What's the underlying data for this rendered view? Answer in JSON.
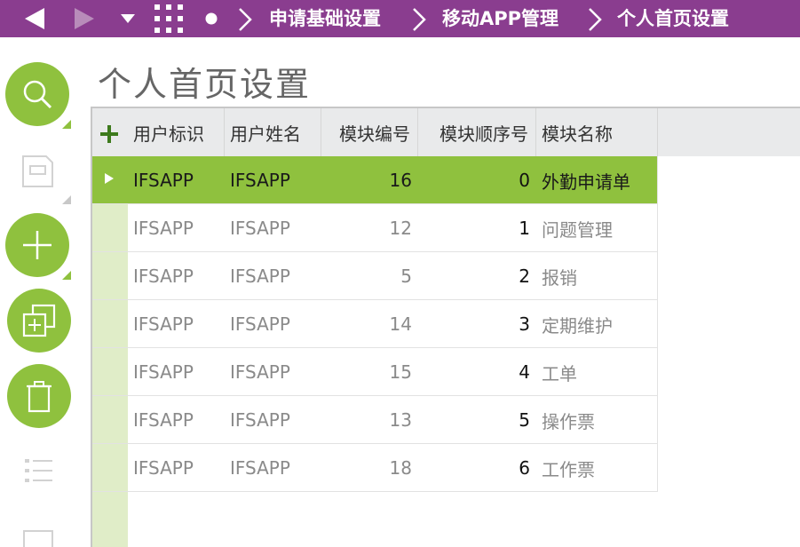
{
  "nav": {
    "crumbs": [
      "申请基础设置",
      "移动APP管理",
      "个人首页设置"
    ]
  },
  "page": {
    "title": "个人首页设置"
  },
  "table": {
    "headers": [
      "用户标识",
      "用户姓名",
      "模块编号",
      "模块顺序号",
      "模块名称"
    ],
    "rows": [
      {
        "user_id": "IFSAPP",
        "user_name": "IFSAPP",
        "module_no": "16",
        "order": "0",
        "module_name": "外勤申请单",
        "selected": true
      },
      {
        "user_id": "IFSAPP",
        "user_name": "IFSAPP",
        "module_no": "12",
        "order": "1",
        "module_name": "问题管理"
      },
      {
        "user_id": "IFSAPP",
        "user_name": "IFSAPP",
        "module_no": "5",
        "order": "2",
        "module_name": "报销"
      },
      {
        "user_id": "IFSAPP",
        "user_name": "IFSAPP",
        "module_no": "14",
        "order": "3",
        "module_name": "定期维护"
      },
      {
        "user_id": "IFSAPP",
        "user_name": "IFSAPP",
        "module_no": "15",
        "order": "4",
        "module_name": "工单"
      },
      {
        "user_id": "IFSAPP",
        "user_name": "IFSAPP",
        "module_no": "13",
        "order": "5",
        "module_name": "操作票"
      },
      {
        "user_id": "IFSAPP",
        "user_name": "IFSAPP",
        "module_no": "18",
        "order": "6",
        "module_name": "工作票"
      }
    ]
  },
  "colors": {
    "topbar": "#8a3d8f",
    "accent": "#8fc13e",
    "selector": "#e0edc8",
    "header": "#e9eaeb"
  },
  "icons": [
    "back-icon",
    "forward-icon",
    "dropdown-icon",
    "apps-grid-icon",
    "dot-icon",
    "search-icon",
    "save-icon",
    "add-icon",
    "duplicate-icon",
    "delete-icon",
    "list-icon"
  ]
}
